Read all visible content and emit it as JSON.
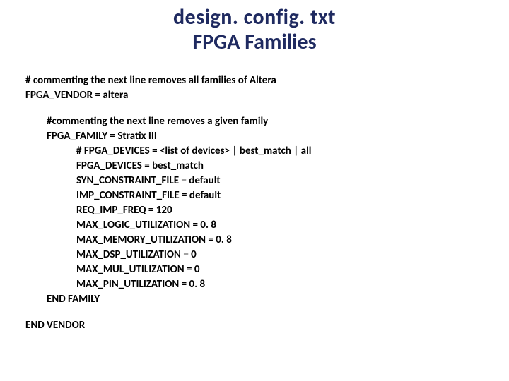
{
  "title": {
    "line1": "design. config. txt",
    "line2": "FPGA Families"
  },
  "config": {
    "vendor_comment": "# commenting the next line removes all families of Altera",
    "vendor_line": "FPGA_VENDOR = altera",
    "family_comment": "#commenting the next line removes a given family",
    "family_line": "FPGA_FAMILY = Stratix III",
    "params": {
      "devices_comment": "# FPGA_DEVICES = <list of devices> | best_match | all",
      "devices": "FPGA_DEVICES = best_match",
      "syn_constraint": "SYN_CONSTRAINT_FILE = default",
      "imp_constraint": "IMP_CONSTRAINT_FILE = default",
      "req_imp_freq": "REQ_IMP_FREQ =  120",
      "max_logic": "MAX_LOGIC_UTILIZATION = 0. 8",
      "max_memory": "MAX_MEMORY_UTILIZATION = 0. 8",
      "max_dsp": "MAX_DSP_UTILIZATION = 0",
      "max_mul": "MAX_MUL_UTILIZATION = 0",
      "max_pin": "MAX_PIN_UTILIZATION = 0. 8"
    },
    "end_family": "END FAMILY",
    "end_vendor": "END VENDOR"
  }
}
